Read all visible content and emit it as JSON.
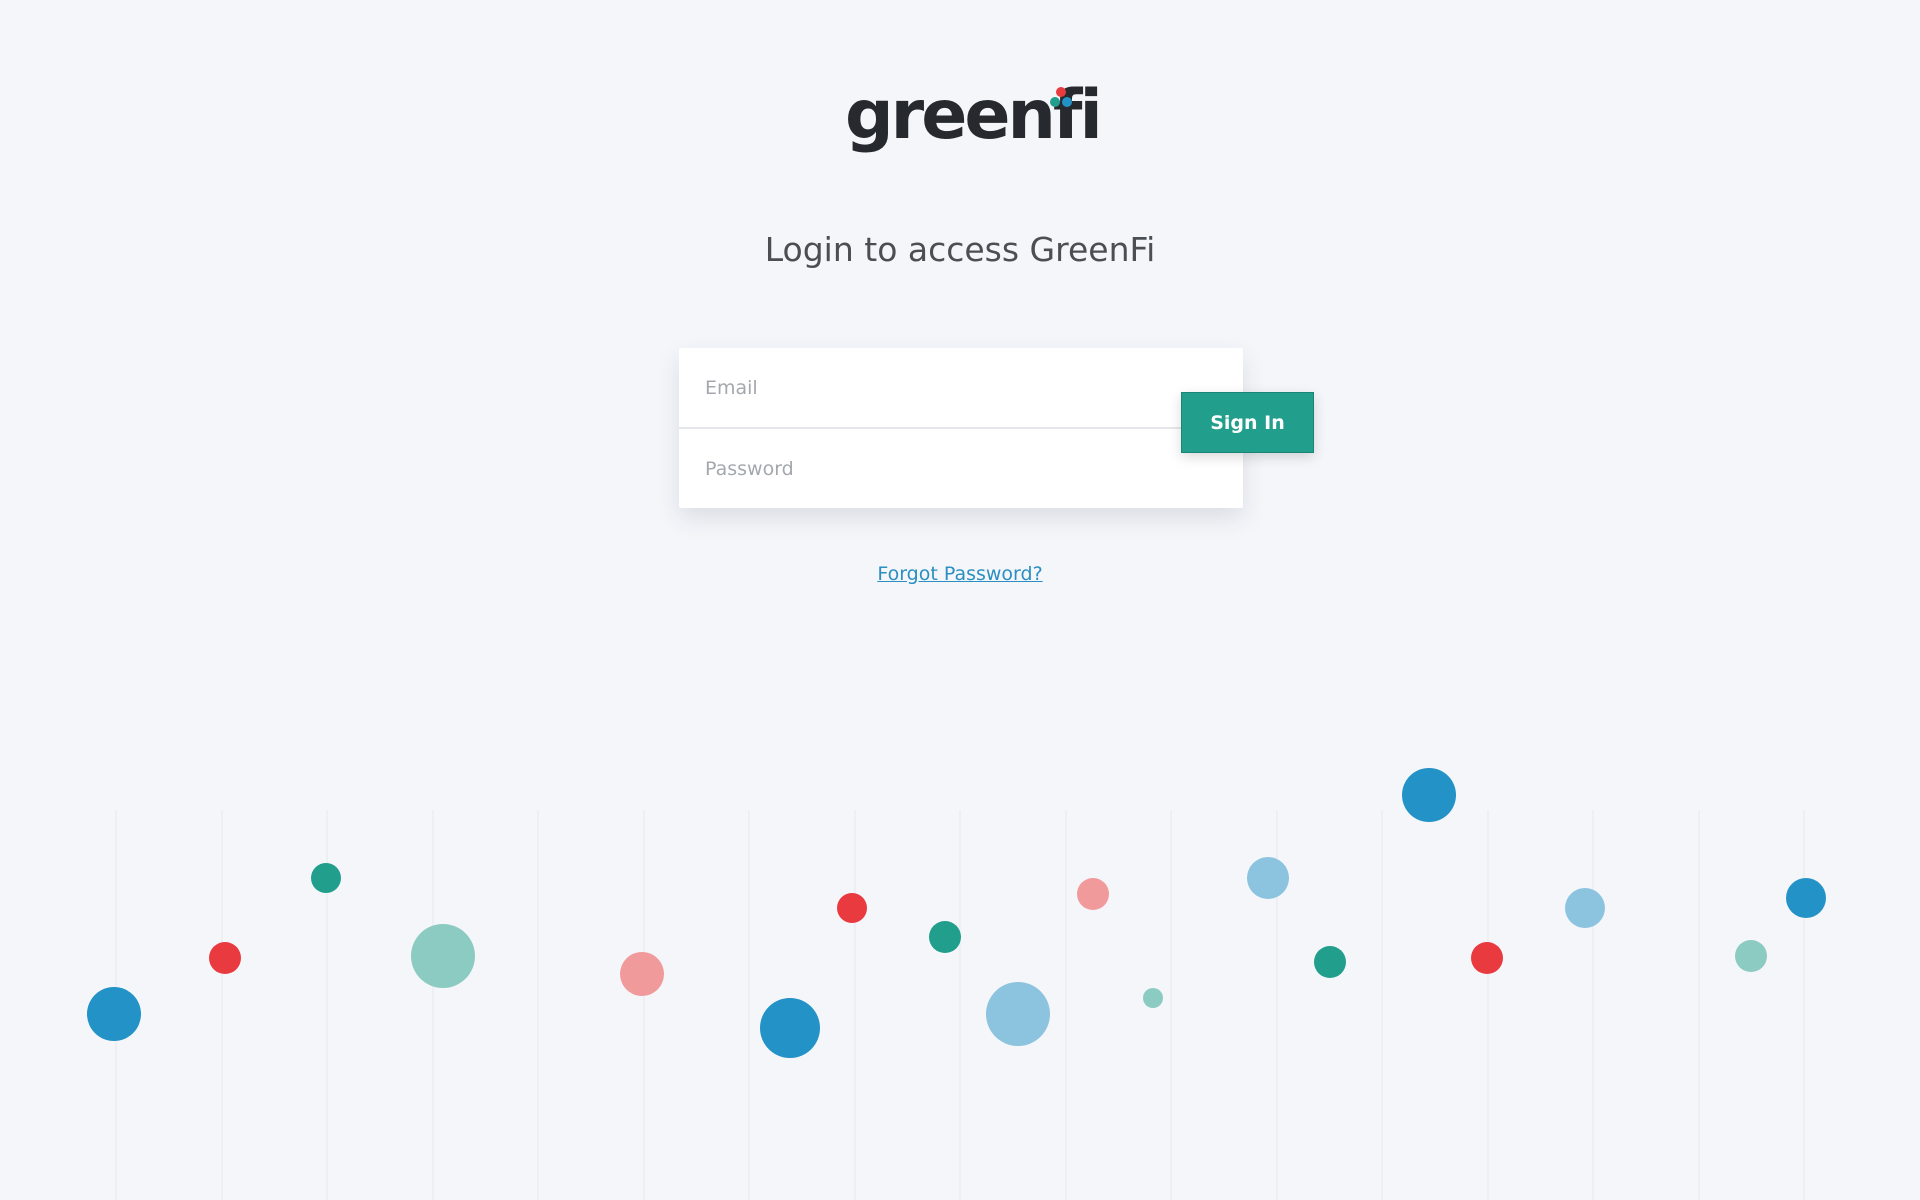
{
  "brand": {
    "logo_text": "greenfi",
    "colors": {
      "teal": "#229e8c",
      "red": "#e93a3f",
      "blue": "#2392c6",
      "light_teal": "#8ccbc2",
      "pink": "#f19a9c",
      "light_blue": "#8cc4e0",
      "dark_text": "#262a2e"
    }
  },
  "headline": "Login to access GreenFi",
  "form": {
    "email_placeholder": "Email",
    "password_placeholder": "Password",
    "signin_label": "Sign In",
    "forgot_label": "Forgot Password?"
  }
}
